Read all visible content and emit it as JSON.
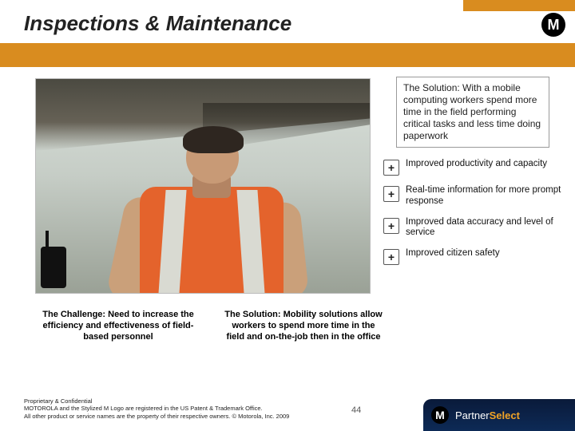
{
  "title": "Inspections & Maintenance",
  "logo_glyph": "M",
  "solution_top": "The Solution: With a mobile computing workers spend more time in the field performing critical tasks and less time doing paperwork",
  "benefits": [
    "Improved productivity and capacity",
    "Real-time information for more prompt response",
    "Improved data accuracy and level of service",
    "Improved citizen safety"
  ],
  "challenge_box": "The Challenge: Need to increase the efficiency and effectiveness of field-based personnel",
  "solution_box": "The Solution: Mobility solutions allow workers to spend more time in the field and on-the-job then in the office",
  "footer": {
    "line1": "Proprietary & Confidential",
    "line2": "MOTOROLA and the Stylized M Logo are registered in the US Patent & Trademark Office.",
    "line3": "All other product or service names are the property of their respective owners. © Motorola, Inc. 2009",
    "page": "44",
    "partner_a": "Partner",
    "partner_b": "Select"
  }
}
